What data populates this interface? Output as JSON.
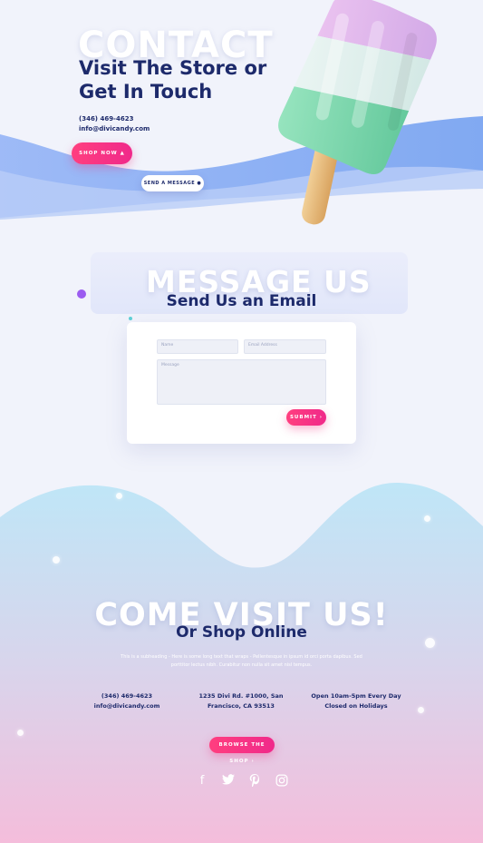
{
  "hero": {
    "ghost_word": "CONTACT",
    "title": "Visit The Store or Get In Touch",
    "phone": "(346) 469-4623",
    "email": "info@divicandy.com",
    "shop_button": "SHOP NOW",
    "message_button": "SEND A MESSAGE"
  },
  "message_section": {
    "ghost_word": "MESSAGE US",
    "title": "Send Us an Email",
    "form": {
      "name_placeholder": "Name",
      "email_placeholder": "Email Address",
      "message_placeholder": "Message",
      "submit_label": "SUBMIT"
    }
  },
  "visit_section": {
    "ghost_word": "COME VISIT US!",
    "title": "Or Shop Online",
    "subheading": "This is a subheading - Here is some long text that wraps - Pellentesque in ipsum id orci porta dapibus. Sed porttitor lectus nibh. Curabitur non nulla sit amet nisl tempus.",
    "contact": {
      "phone": "(346) 469-4623",
      "email": "info@divicandy.com"
    },
    "address": {
      "line1": "1235 Divi Rd. #1000, San",
      "line2": "Francisco, CA 93513"
    },
    "hours": {
      "line1": "Open 10am-5pm Every Day",
      "line2": "Closed on Holidays"
    },
    "browse_button": "BROWSE THE SHOP",
    "social": [
      "facebook-icon",
      "twitter-icon",
      "pinterest-icon",
      "instagram-icon"
    ]
  },
  "colors": {
    "navy": "#1d2a6b",
    "pink": "#f0298a",
    "wave_blue": "#7aa2f2",
    "footer_top": "#bfe6f7",
    "footer_bottom": "#f4bddb"
  }
}
